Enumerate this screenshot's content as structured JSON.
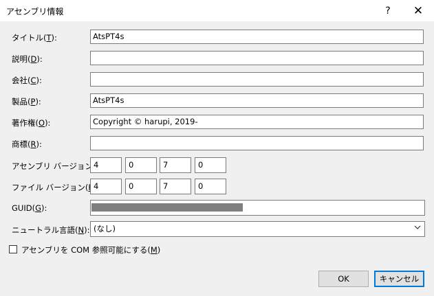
{
  "window": {
    "title": "アセンブリ情報",
    "help_glyph": "?",
    "close_glyph": "✕"
  },
  "fields": {
    "title": {
      "label_pre": "タイトル(",
      "key": "T",
      "label_post": "):",
      "value": "AtsPT4s"
    },
    "description": {
      "label_pre": "説明(",
      "key": "D",
      "label_post": "):",
      "value": ""
    },
    "company": {
      "label_pre": "会社(",
      "key": "C",
      "label_post": "):",
      "value": ""
    },
    "product": {
      "label_pre": "製品(",
      "key": "P",
      "label_post": "):",
      "value": "AtsPT4s"
    },
    "copyright": {
      "label_pre": "著作権(",
      "key": "O",
      "label_post": "):",
      "value": "Copyright ©  harupi, 2019-"
    },
    "trademark": {
      "label_pre": "商標(",
      "key": "R",
      "label_post": "):",
      "value": ""
    }
  },
  "assembly_version": {
    "label_pre": "アセンブリ バージョン(",
    "key": "A",
    "label_post": "):",
    "values": [
      "4",
      "0",
      "7",
      "0"
    ]
  },
  "file_version": {
    "label_pre": "ファイル バージョン(",
    "key": "F",
    "label_post": "):",
    "values": [
      "4",
      "0",
      "7",
      "0"
    ]
  },
  "guid": {
    "label_pre": "GUID(",
    "key": "G",
    "label_post": "):"
  },
  "neutral_language": {
    "label_pre": "ニュートラル言語(",
    "key": "N",
    "label_post": "):",
    "value": "(なし)"
  },
  "com_visible": {
    "label_pre": "アセンブリを COM 参照可能にする(",
    "key": "M",
    "label_post": ")",
    "checked": false
  },
  "buttons": {
    "ok": "OK",
    "cancel": "キャンセル"
  }
}
